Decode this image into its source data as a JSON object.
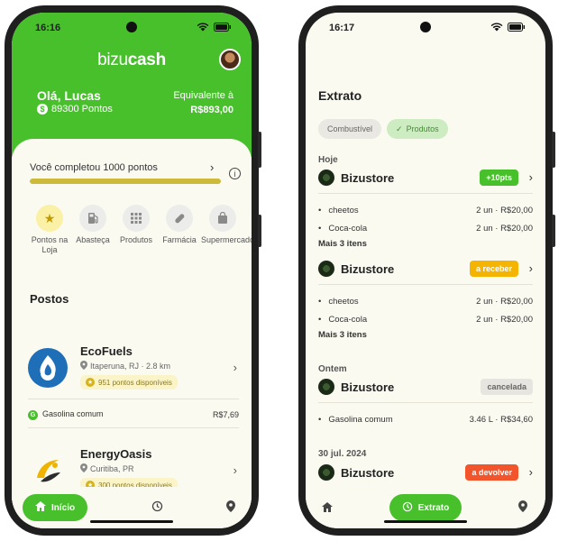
{
  "left_phone": {
    "status": {
      "time": "16:16",
      "signal_icon": "wifi-icon",
      "battery_icon": "battery-icon"
    },
    "header": {
      "logo_prefix": "bizu",
      "logo_suffix": "cash",
      "greeting": "Olá, Lucas",
      "points_label": "89300 Pontos",
      "equivalent_label": "Equivalente à",
      "equivalent_value": "R$893,00",
      "color": "#47c02c"
    },
    "progress": {
      "title": "Você completou 1000 pontos",
      "fraction": 1.0
    },
    "categories": [
      {
        "label": "Pontos na Loja",
        "icon": "star-icon",
        "active": true
      },
      {
        "label": "Abasteça",
        "icon": "fuel-pump-icon",
        "active": false
      },
      {
        "label": "Produtos",
        "icon": "grid-icon",
        "active": false
      },
      {
        "label": "Farmácia",
        "icon": "pill-icon",
        "active": false
      },
      {
        "label": "Supermercado",
        "icon": "shopping-bag-icon",
        "active": false
      }
    ],
    "section_title": "Postos",
    "stations": [
      {
        "name": "EcoFuels",
        "location": "Itaperuna, RJ · 2.8 km",
        "badge": "951 pontos disponíveis"
      },
      {
        "name": "EnergyOasis",
        "location": "Curitiba, PR",
        "badge": "300 pontos disponíveis"
      }
    ],
    "fuel": {
      "name": "Gasolina comum",
      "price": "R$7,69"
    },
    "nav": {
      "home_label": "Início",
      "history_icon": "history-icon",
      "map_icon": "location-pin-icon"
    }
  },
  "right_phone": {
    "status": {
      "time": "16:17"
    },
    "title": "Extrato",
    "chips": [
      {
        "label": "Combustível",
        "active": false
      },
      {
        "label": "Produtos",
        "active": true
      }
    ],
    "groups": {
      "today": "Hoje",
      "yesterday": "Ontem",
      "date": "30 jul. 2024"
    },
    "orders": [
      {
        "store": "Bizustore",
        "tag": "+10pts",
        "tag_color": "#47c02c",
        "items": [
          {
            "name": "cheetos",
            "detail": "2 un · R$20,00"
          },
          {
            "name": "Coca-cola",
            "detail": "2 un · R$20,00"
          }
        ],
        "more": "Mais 3 itens"
      },
      {
        "store": "Bizustore",
        "tag": "a receber",
        "tag_color": "#f5b400",
        "items": [
          {
            "name": "cheetos",
            "detail": "2 un · R$20,00"
          },
          {
            "name": "Coca-cola",
            "detail": "2 un · R$20,00"
          }
        ],
        "more": "Mais 3 itens"
      },
      {
        "store": "Bizustore",
        "tag": "cancelada",
        "tag_color": "#e6e5df",
        "items": [
          {
            "name": "Gasolina comum",
            "detail": "3.46 L · R$34,60"
          }
        ]
      },
      {
        "store": "Bizustore",
        "tag": "a devolver",
        "tag_color": "#f2552c",
        "items": []
      }
    ],
    "nav": {
      "active_label": "Extrato"
    }
  }
}
